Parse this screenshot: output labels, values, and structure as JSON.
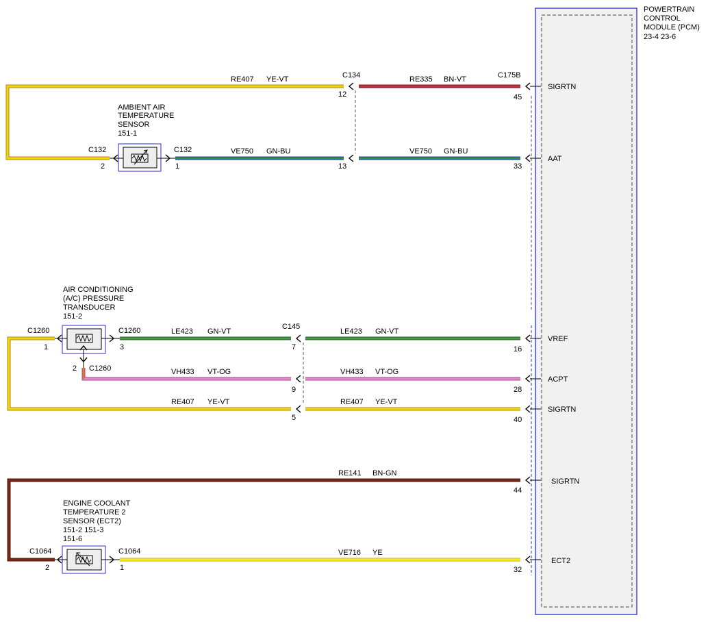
{
  "module": {
    "title_lines": [
      "POWERTRAIN",
      "CONTROL",
      "MODULE (PCM)"
    ],
    "pages": "23-4    23-6"
  },
  "components": {
    "aat_sensor": {
      "lines": [
        "AMBIENT AIR",
        "TEMPERATURE",
        "SENSOR",
        "151-1"
      ]
    },
    "ac_transducer": {
      "lines": [
        "AIR CONDITIONING",
        "(A/C) PRESSURE",
        "TRANSDUCER",
        "151-2"
      ]
    },
    "ect2_sensor": {
      "lines": [
        "ENGINE COOLANT",
        "TEMPERATURE 2",
        "SENSOR (ECT2)",
        "151-2   151-3",
        "151-6"
      ]
    }
  },
  "connectors": {
    "c134": "C134",
    "c175b": "C175B",
    "c132_left": "C132",
    "c132_right": "C132",
    "c1260_left": "C1260",
    "c1260_right": "C1260",
    "c1260_bottom": "C1260",
    "c145": "C145",
    "c1064_left": "C1064",
    "c1064_right": "C1064"
  },
  "circuits": {
    "re407_top": {
      "id": "RE407",
      "color": "YE-VT"
    },
    "re335": {
      "id": "RE335",
      "color": "BN-VT"
    },
    "ve750_left": {
      "id": "VE750",
      "color": "GN-BU"
    },
    "ve750_right": {
      "id": "VE750",
      "color": "GN-BU"
    },
    "le423_left": {
      "id": "LE423",
      "color": "GN-VT"
    },
    "le423_right": {
      "id": "LE423",
      "color": "GN-VT"
    },
    "vh433_left": {
      "id": "VH433",
      "color": "VT-OG"
    },
    "vh433_right": {
      "id": "VH433",
      "color": "VT-OG"
    },
    "re407_mid_left": {
      "id": "RE407",
      "color": "YE-VT"
    },
    "re407_mid_right": {
      "id": "RE407",
      "color": "YE-VT"
    },
    "re141": {
      "id": "RE141",
      "color": "BN-GN"
    },
    "ve716": {
      "id": "VE716",
      "color": "YE"
    }
  },
  "pins": {
    "c134_re407": "12",
    "c175b_sigrtn": "45",
    "c132_left": "2",
    "c132_right": "1",
    "c134_ve750": "13",
    "pcm_aat": "33",
    "c1260_left": "1",
    "c1260_right": "3",
    "c145_le423": "7",
    "pcm_vref": "16",
    "c1260_bottom": "2",
    "c145_vh433": "9",
    "pcm_acpt": "28",
    "c145_re407": "5",
    "pcm_sigrtn2": "40",
    "pcm_sigrtn3": "44",
    "c1064_left": "2",
    "c1064_right": "1",
    "pcm_ect2": "32"
  },
  "signals": {
    "sigrtn_1": "SIGRTN",
    "aat": "AAT",
    "vref": "VREF",
    "acpt": "ACPT",
    "sigrtn_2": "SIGRTN",
    "sigrtn_3": "SIGRTN",
    "ect2": "ECT2"
  },
  "wire_colors": {
    "yellow": "#f2d616",
    "yellow_violet": "#f2d616",
    "brown_violet": "#c0303c",
    "green_blue": "#3a8a3a",
    "green_violet": "#3d8a3d",
    "violet_orange": "#e58ac9",
    "brown_green": "#7a2518",
    "pcm_border": "#2b2bd6"
  }
}
